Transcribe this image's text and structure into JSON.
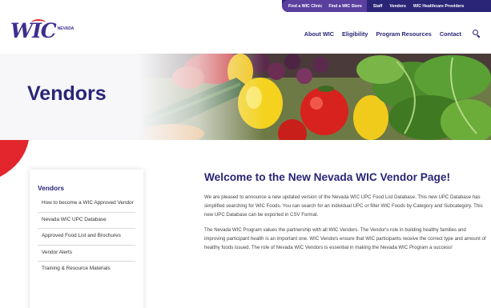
{
  "utility_nav": {
    "find_clinic": "Find a WIC Clinic",
    "find_store": "Find a WIC Store",
    "staff": "Staff",
    "vendors": "Vendors",
    "providers": "WIC Healthcare Providers"
  },
  "logo": {
    "wordmark": "WIC",
    "state": "NEVADA"
  },
  "main_nav": {
    "about": "About WIC",
    "eligibility": "Eligibility",
    "resources": "Program Resources",
    "contact": "Contact"
  },
  "hero": {
    "title": "Vendors"
  },
  "sidebar": {
    "title": "Vendors",
    "items": [
      {
        "label": "How to become a WIC Approved Vendor"
      },
      {
        "label": "Nevada WIC UPC Database"
      },
      {
        "label": "Approved Food List and Brochures"
      },
      {
        "label": "Vendor Alerts"
      },
      {
        "label": "Training & Resource Materials"
      }
    ]
  },
  "content": {
    "title": "Welcome to the New Nevada WIC Vendor Page!",
    "paragraphs": [
      "We are pleased to announce a new updated version of the Nevada WIC UPC Food List Database. This new UPC Database has simplified searching for WIC Foods. You can search for an individual UPC or filter WIC Foods by Category and Subcategory. This new UPC Database can be exported in CSV Format.",
      "The Nevada WIC Program values the partnership with all WIC Vendors. The Vendor's role in building healthy families and improving participant health is an important one. WIC Vendors ensure that WIC participants receive the correct type and amount of healthy foods issued. The role of Nevada WIC Vendors is essential in making the Nevada WIC Program a success!"
    ]
  },
  "colors": {
    "brand_navy": "#2b2577",
    "brand_purple": "#5a3f9e",
    "accent_red": "#e3262d"
  }
}
